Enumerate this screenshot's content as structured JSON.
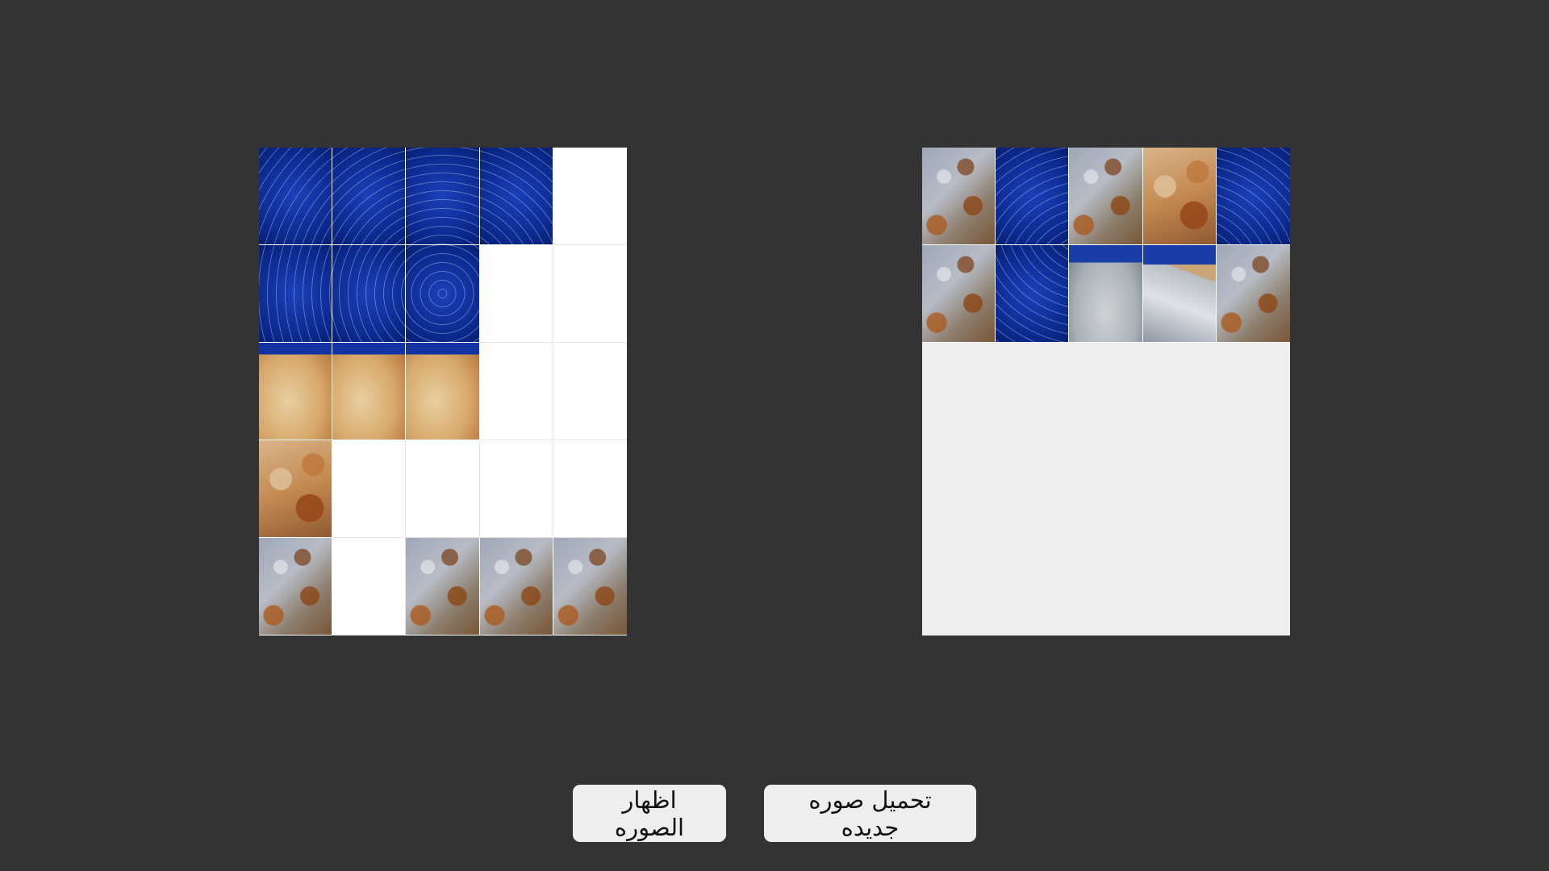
{
  "buttons": {
    "show_image": "اظهار الصوره",
    "load_new_image": "تحميل صوره جديده"
  },
  "grid": {
    "rows": 5,
    "cols": 5
  },
  "board": {
    "filled_cells": [
      {
        "row": 1,
        "col": 1,
        "tile": "sky"
      },
      {
        "row": 1,
        "col": 2,
        "tile": "sky"
      },
      {
        "row": 1,
        "col": 3,
        "tile": "sky"
      },
      {
        "row": 1,
        "col": 4,
        "tile": "sky"
      },
      {
        "row": 2,
        "col": 1,
        "tile": "sky"
      },
      {
        "row": 2,
        "col": 2,
        "tile": "sky"
      },
      {
        "row": 2,
        "col": 3,
        "tile": "sky"
      },
      {
        "row": 3,
        "col": 1,
        "tile": "rock-top"
      },
      {
        "row": 3,
        "col": 2,
        "tile": "rock-top"
      },
      {
        "row": 3,
        "col": 3,
        "tile": "rock-top"
      },
      {
        "row": 4,
        "col": 1,
        "tile": "rock-warm"
      },
      {
        "row": 5,
        "col": 1,
        "tile": "rock"
      },
      {
        "row": 5,
        "col": 3,
        "tile": "rock"
      },
      {
        "row": 5,
        "col": 4,
        "tile": "rock"
      },
      {
        "row": 5,
        "col": 5,
        "tile": "rock"
      }
    ]
  },
  "tray": {
    "pieces": [
      "rock",
      "sky",
      "rock",
      "rock-warm",
      "sky",
      "rock",
      "sky",
      "dome",
      "slope",
      "rock"
    ]
  }
}
